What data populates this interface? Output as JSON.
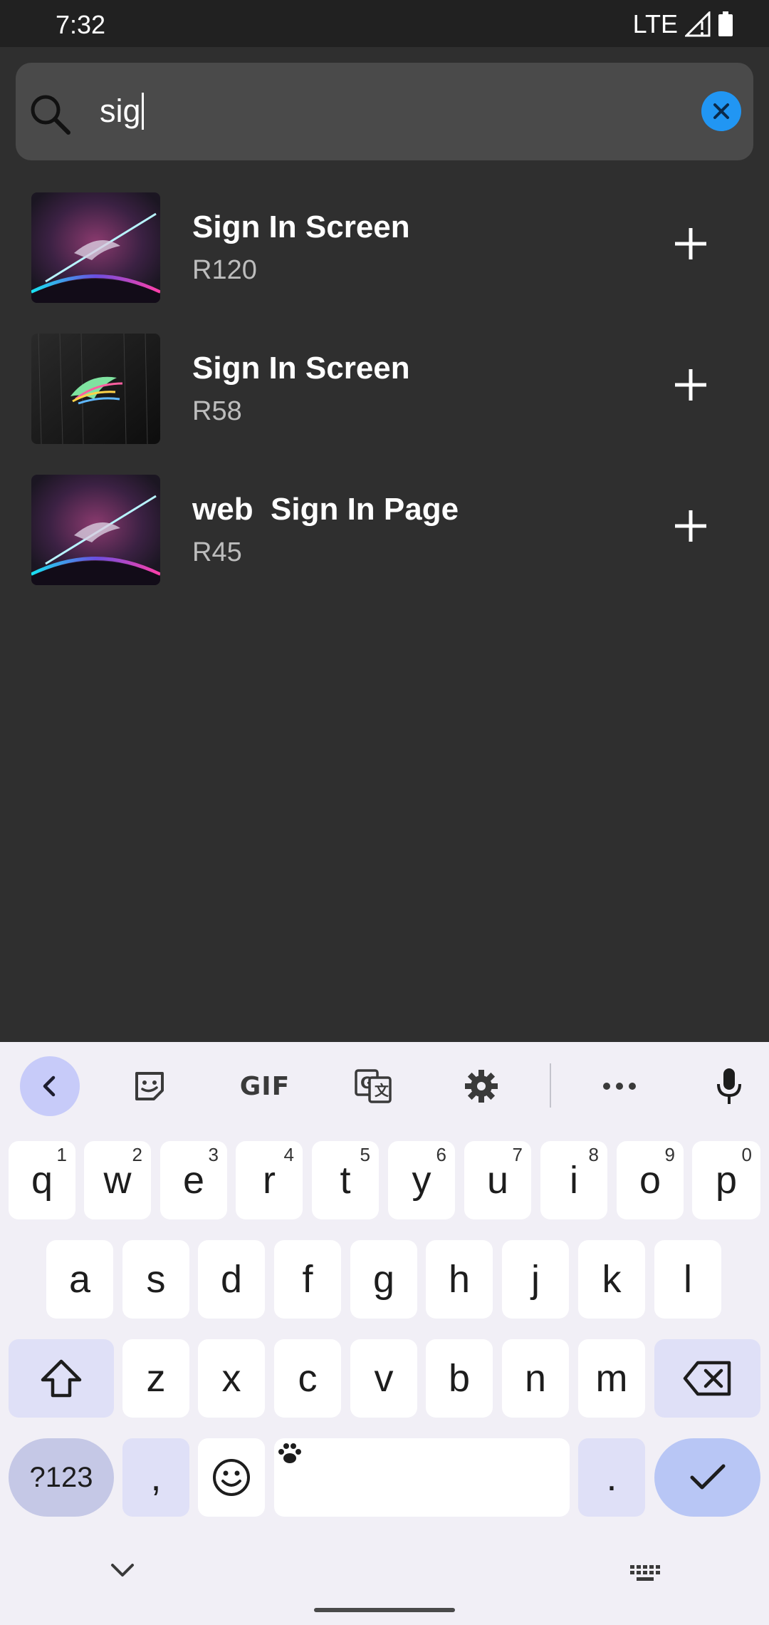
{
  "status_bar": {
    "time": "7:32",
    "network": "LTE"
  },
  "search": {
    "query": "sig"
  },
  "results": [
    {
      "title": "Sign In Screen",
      "price": "R120"
    },
    {
      "title": "Sign In Screen",
      "price": "R58"
    },
    {
      "title": "web  Sign In Page",
      "price": "R45"
    }
  ],
  "keyboard": {
    "toolbar": {
      "gif_label": "GIF"
    },
    "row1": [
      {
        "char": "q",
        "hint": "1"
      },
      {
        "char": "w",
        "hint": "2"
      },
      {
        "char": "e",
        "hint": "3"
      },
      {
        "char": "r",
        "hint": "4"
      },
      {
        "char": "t",
        "hint": "5"
      },
      {
        "char": "y",
        "hint": "6"
      },
      {
        "char": "u",
        "hint": "7"
      },
      {
        "char": "i",
        "hint": "8"
      },
      {
        "char": "o",
        "hint": "9"
      },
      {
        "char": "p",
        "hint": "0"
      }
    ],
    "row2": [
      "a",
      "s",
      "d",
      "f",
      "g",
      "h",
      "j",
      "k",
      "l"
    ],
    "row3": [
      "z",
      "x",
      "c",
      "v",
      "b",
      "n",
      "m"
    ],
    "symbols_label": "?123",
    "comma": ",",
    "period": "."
  },
  "colors": {
    "accent": "#2196f3",
    "background": "#2f2f2f",
    "keyboard": "#f1eff6"
  }
}
